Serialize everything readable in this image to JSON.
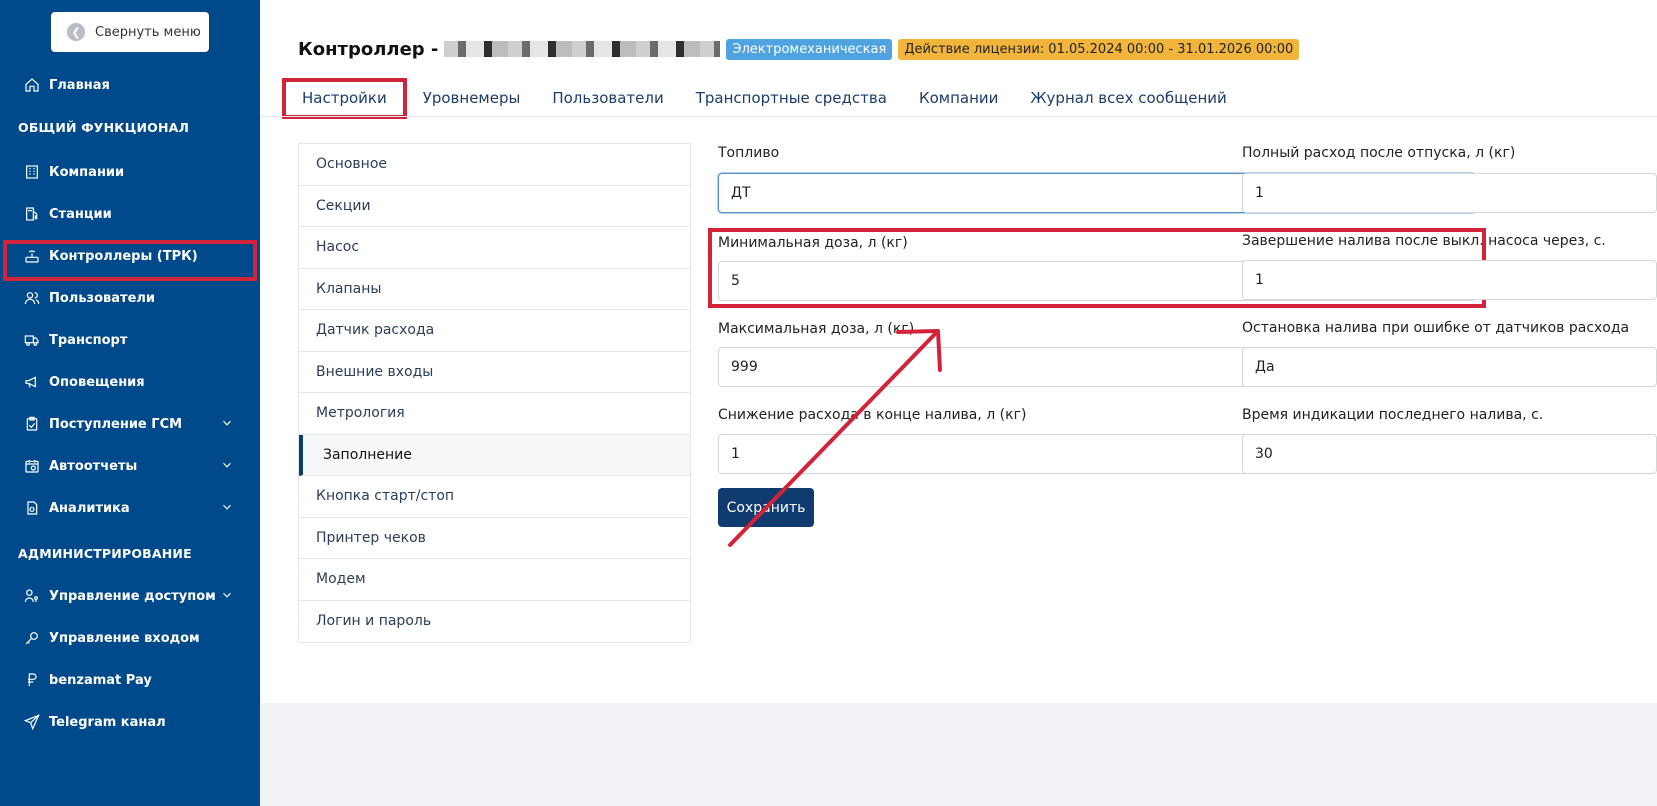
{
  "sidebar": {
    "collapse_label": "Свернуть меню",
    "items": [
      {
        "label": "Главная",
        "icon": "home-icon"
      },
      {
        "label": "Компании",
        "icon": "building-icon"
      },
      {
        "label": "Станции",
        "icon": "fuel-station-icon"
      },
      {
        "label": "Контроллеры (ТРК)",
        "icon": "router-icon"
      },
      {
        "label": "Пользователи",
        "icon": "users-icon"
      },
      {
        "label": "Транспорт",
        "icon": "truck-icon"
      },
      {
        "label": "Оповещения",
        "icon": "megaphone-icon"
      },
      {
        "label": "Поступление ГСМ",
        "icon": "clipboard-icon"
      },
      {
        "label": "Автоотчеты",
        "icon": "calendar-clock-icon"
      },
      {
        "label": "Аналитика",
        "icon": "analytics-icon"
      },
      {
        "label": "Управление доступом",
        "icon": "user-key-icon"
      },
      {
        "label": "Управление входом",
        "icon": "key-icon"
      },
      {
        "label": "benzamat Pay",
        "icon": "ruble-icon"
      },
      {
        "label": "Telegram канал",
        "icon": "send-icon"
      }
    ],
    "sections": {
      "general": "ОБЩИЙ ФУНКЦИОНАЛ",
      "admin": "АДМИНИСТРИРОВАНИЕ"
    }
  },
  "header": {
    "title": "Контроллер -",
    "badge_type": "Электромеханическая",
    "badge_license": "Действие лицензии: 01.05.2024 00:00 - 31.01.2026 00:00"
  },
  "tabs": [
    "Настройки",
    "Уровнемеры",
    "Пользователи",
    "Транспортные средства",
    "Компании",
    "Журнал всех сообщений"
  ],
  "submenu": [
    "Основное",
    "Секции",
    "Насос",
    "Клапаны",
    "Датчик расхода",
    "Внешние входы",
    "Метрология",
    "Заполнение",
    "Кнопка старт/стоп",
    "Принтер чеков",
    "Модем",
    "Логин и пароль"
  ],
  "form": {
    "fuel_label": "Топливо",
    "fuel_value": "ДТ",
    "min_dose_label": "Минимальная доза, л (кг)",
    "min_dose_value": "5",
    "max_dose_label": "Максимальная доза, л (кг)",
    "max_dose_value": "999",
    "reduce_label": "Снижение расхода в конце налива, л (кг)",
    "reduce_value": "1",
    "full_flow_label": "Полный расход после отпуска, л (кг)",
    "full_flow_value": "1",
    "finish_label": "Завершение налива после выкл. насоса через, с.",
    "finish_value": "1",
    "stop_label": "Остановка налива при ошибке от датчиков расхода",
    "stop_value": "Да",
    "indication_label": "Время индикации последнего налива, с.",
    "indication_value": "30",
    "save_label": "Сохранить"
  },
  "colors": {
    "sidebar_bg": "#004a8c",
    "highlight": "#d3233a",
    "primary_button": "#0f3b6e",
    "badge_type": "#4ea3e0",
    "badge_license": "#f2b53c"
  }
}
